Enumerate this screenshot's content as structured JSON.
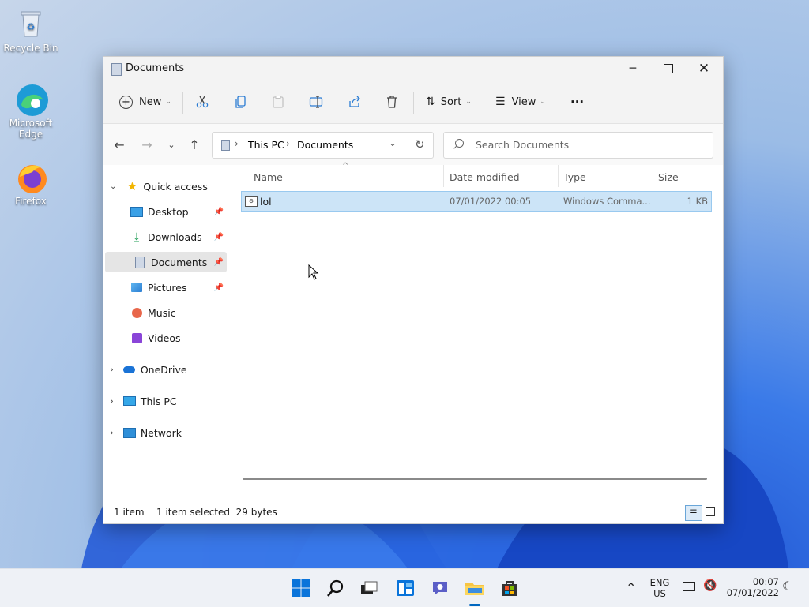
{
  "desktop": {
    "icons": [
      {
        "label": "Recycle Bin"
      },
      {
        "label": "Microsoft Edge"
      },
      {
        "label": "Firefox"
      }
    ]
  },
  "window": {
    "title": "Documents",
    "toolbar": {
      "new_label": "New",
      "sort_label": "Sort",
      "view_label": "View",
      "more_label": "···"
    },
    "nav": {
      "breadcrumb": [
        "This PC",
        "Documents"
      ],
      "search_placeholder": "Search Documents"
    },
    "sidebar": {
      "quick_access": "Quick access",
      "items": [
        {
          "label": "Desktop",
          "pinned": true
        },
        {
          "label": "Downloads",
          "pinned": true
        },
        {
          "label": "Documents",
          "pinned": true,
          "selected": true
        },
        {
          "label": "Pictures",
          "pinned": true
        },
        {
          "label": "Music",
          "pinned": false
        },
        {
          "label": "Videos",
          "pinned": false
        }
      ],
      "onedrive": "OneDrive",
      "this_pc": "This PC",
      "network": "Network"
    },
    "file_list": {
      "columns": [
        "Name",
        "Date modified",
        "Type",
        "Size"
      ],
      "rows": [
        {
          "name": "lol",
          "date_modified": "07/01/2022 00:05",
          "type": "Windows Comma...",
          "size": "1 KB",
          "selected": true
        }
      ]
    },
    "status": {
      "item_count": "1 item",
      "selection": "1 item selected  29 bytes"
    }
  },
  "taskbar": {
    "lang_line1": "ENG",
    "lang_line2": "US",
    "time": "00:07",
    "date": "07/01/2022"
  },
  "colors": {
    "accent": "#0067c0",
    "selection_bg": "#cce4f7",
    "selection_border": "#99c9ef",
    "sidebar_selected": "#e5e5e5"
  }
}
